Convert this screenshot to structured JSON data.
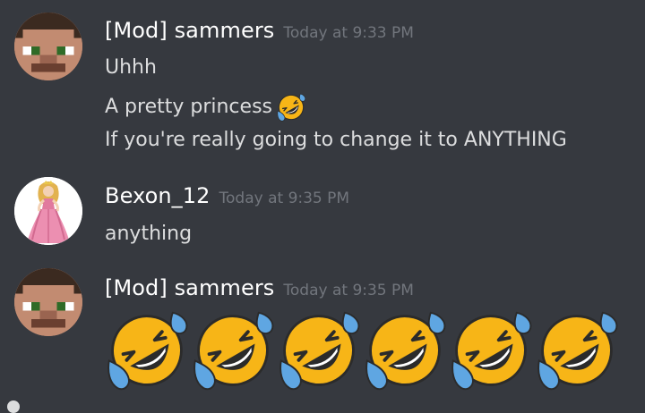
{
  "messages": [
    {
      "author": "[Mod] sammers",
      "timestamp": "Today at 9:33 PM",
      "avatar": "minecraft-steve-face-icon",
      "lines": [
        {
          "text": "Uhhh"
        },
        {
          "text": "A pretty princess",
          "emoji": "rolling-on-floor-laughing-emoji"
        },
        {
          "text": "If you're really going to change it to ANYTHING"
        }
      ]
    },
    {
      "author": "Bexon_12",
      "timestamp": "Today at 9:35 PM",
      "avatar": "princess-avatar-icon",
      "lines": [
        {
          "text": "anything"
        }
      ]
    },
    {
      "author": "[Mod] sammers",
      "timestamp": "Today at 9:35 PM",
      "avatar": "minecraft-steve-face-icon",
      "jumbo_emoji": {
        "name": "rolling-on-floor-laughing-emoji",
        "count": 6
      }
    }
  ],
  "colors": {
    "background": "#36393f",
    "username": "#ffffff",
    "message_text": "#dcddde",
    "timestamp": "#72767d",
    "emoji_face": "#f4b400",
    "emoji_tear": "#5ea3e0"
  }
}
